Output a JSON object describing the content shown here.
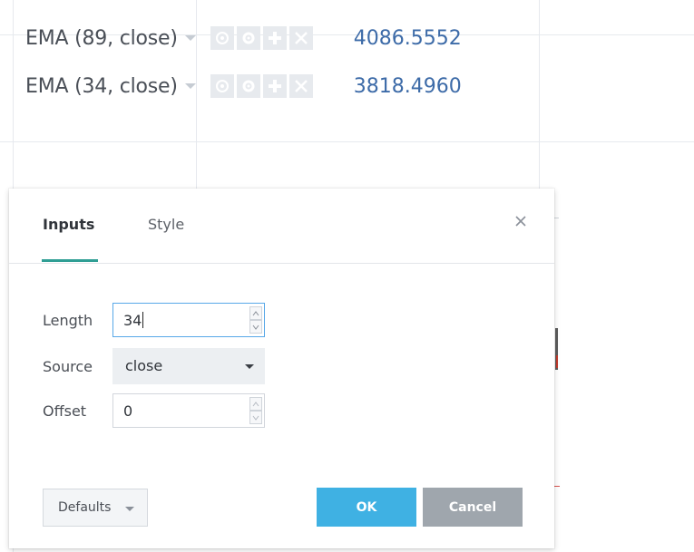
{
  "legend": {
    "rows": [
      {
        "name": "EMA (89, close)",
        "value": "4086.5552"
      },
      {
        "name": "EMA (34, close)",
        "value": "3818.4960"
      }
    ],
    "buttons": [
      "eye-icon",
      "gear-icon",
      "plus-icon",
      "close-icon"
    ]
  },
  "dialog": {
    "tabs": [
      {
        "label": "Inputs",
        "active": true
      },
      {
        "label": "Style",
        "active": false
      }
    ],
    "close_icon": "×",
    "fields": {
      "length": {
        "label": "Length",
        "value": "34"
      },
      "source": {
        "label": "Source",
        "value": "close"
      },
      "offset": {
        "label": "Offset",
        "value": "0"
      }
    },
    "footer": {
      "defaults_label": "Defaults",
      "ok_label": "OK",
      "cancel_label": "Cancel"
    }
  },
  "colors": {
    "value_text": "#3d6ba8",
    "tab_accent": "#2f9e94",
    "ok": "#3fb1e3",
    "cancel": "#9fa6ad"
  }
}
